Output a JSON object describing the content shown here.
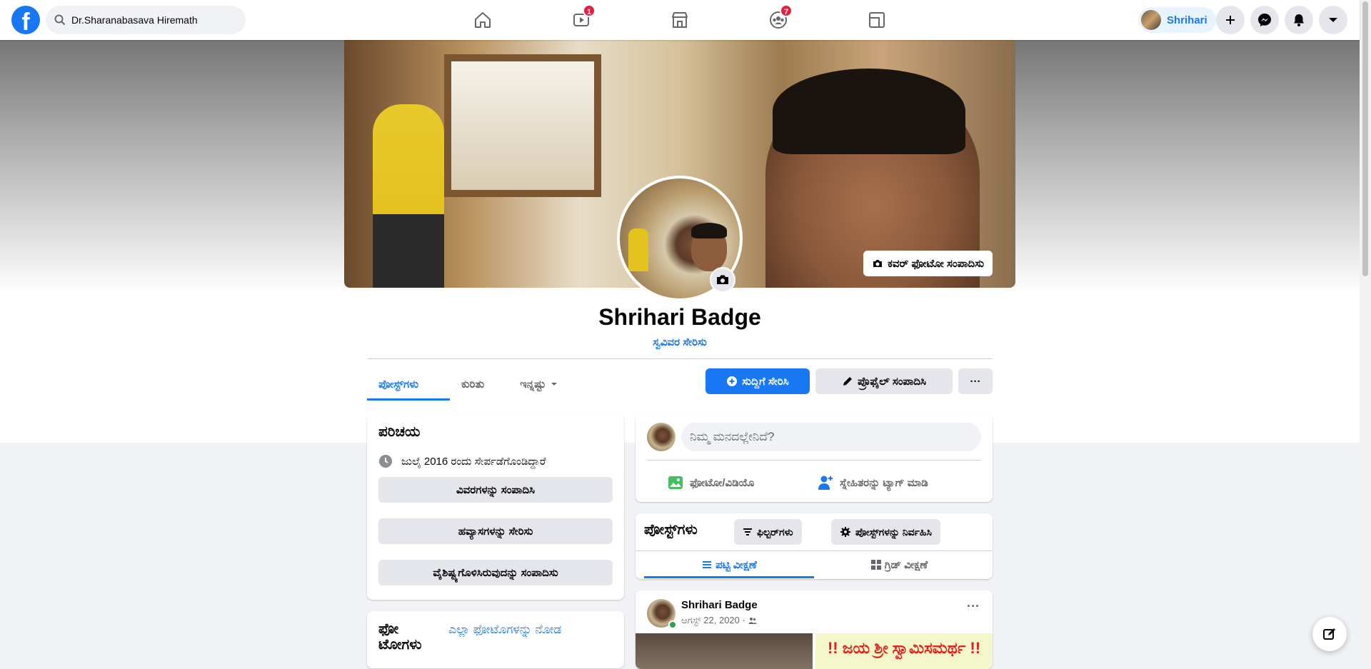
{
  "topbar": {
    "logo": "f",
    "search_value": "Dr.Sharanabasava Hiremath",
    "watch_badge": "1",
    "groups_badge": "7",
    "profile_name": "Shrihari"
  },
  "cover": {
    "edit_cover_label": "ಕವರ್ ಫೋಟೋ ಸಂಪಾದಿಸು"
  },
  "profile": {
    "name": "Shrihari Badge",
    "bio_link": "ಸ್ವವಿವರ ಸೇರಿಸು"
  },
  "tabs": [
    {
      "label": "ಪೋಸ್ಟ್‌ಗಳು"
    },
    {
      "label": "ಕುರಿತು"
    },
    {
      "label": "ಇನ್ನಷ್ಟು"
    }
  ],
  "actions": {
    "add_story": "ಸುದ್ದಿಗೆ ಸೇರಿಸಿ",
    "edit_profile": "ಪ್ರೊಫೈಲ್ ಸಂಪಾದಿಸಿ",
    "more": "···"
  },
  "intro": {
    "title": "ಪರಿಚಯ",
    "joined": "ಜುಲೈ 2016 ರಂದು ಸೇರ್ಪಡೆಗೊಂಡಿದ್ದಾರೆ",
    "edit_details": "ವಿವರಗಳನ್ನು ಸಂಪಾದಿಸಿ",
    "add_hobbies": "ಹವ್ಯಾಸಗಳನ್ನು ಸೇರಿಸು",
    "edit_featured": "ವೈಶಿಷ್ಟ್ಯಗೊಳಿಸಿರುವುದನ್ನು ಸಂಪಾದಿಸು"
  },
  "photos": {
    "title": "ಫೋ ಟೋಗಳು",
    "see_all": "ಎಲ್ಲಾ ಫೋಟೊಗಳನ್ನು ನೋಡ"
  },
  "composer": {
    "placeholder": "ನಿಮ್ಮ ಮನದಲ್ಲೇನಿದೆ?",
    "photo_video": "ಫೋಟೋ/ವಿಡಿಯೊ",
    "tag_friends": "ಸ್ನೇಹಿತರನ್ನು ಟ್ಯಾಗ್ ಮಾಡಿ"
  },
  "posts_header": {
    "title": "ಪೋಸ್ಟ್‌ಗಳು",
    "filters": "ಫಿಲ್ಟರ್‌ಗಳು",
    "manage": "ಪೋಸ್ಟ್‌ಗಳನ್ನು ನಿರ್ವಹಿಸಿ",
    "list_view": "ಪಟ್ಟಿ ವೀಕ್ಷಣೆ",
    "grid_view": "ಗ್ರಿಡ್ ವೀಕ್ಷಣೆ"
  },
  "post": {
    "author": "Shrihari Badge",
    "date": "ಆಗಸ್ಟ್ 22, 2020 ·",
    "more": "···",
    "image_text": "!! ಜಯ ಶ್ರೀ ಸ್ವಾಮಿಸಮರ್ಥ !!"
  },
  "colors": {
    "brand": "#1877f2",
    "badge": "#e41e3f",
    "online": "#31a24c"
  }
}
